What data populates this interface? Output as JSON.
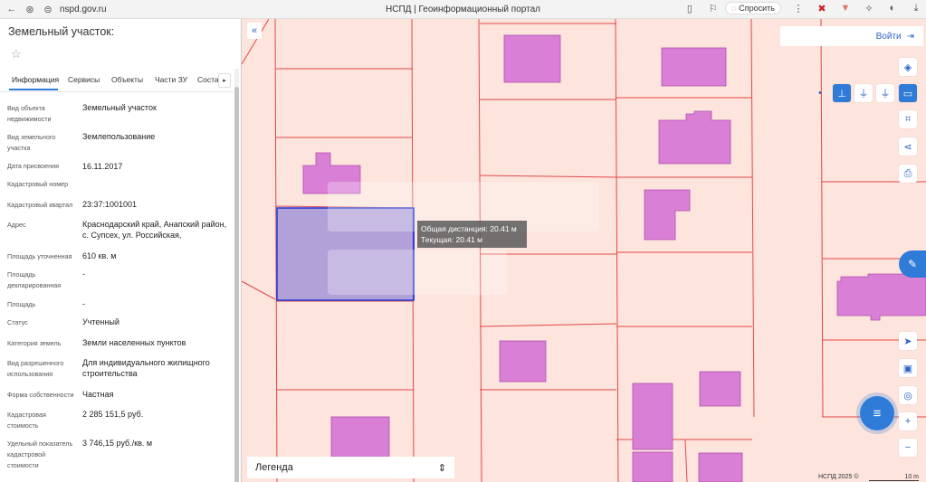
{
  "browser": {
    "url": "nspd.gov.ru",
    "title": "НСПД | Геоинформационный портал",
    "ask_label": "Спросить"
  },
  "panel": {
    "title": "Земельный участок:",
    "tabs": [
      "Информация",
      "Сервисы",
      "Объекты",
      "Части ЗУ",
      "Соста"
    ],
    "fields": [
      {
        "label": "Вид объекта недвижимости",
        "value": "Земельный участок"
      },
      {
        "label": "Вид земельного участка",
        "value": "Землепользование"
      },
      {
        "label": "Дата присвоения",
        "value": "16.11.2017"
      },
      {
        "label": "Кадастровый номер",
        "value": ""
      },
      {
        "label": "Кадастровый квартал",
        "value": "23:37:1001001"
      },
      {
        "label": "Адрес",
        "value": "Краснодарский край, Анапский район, с. Супсех, ул. Российская,"
      },
      {
        "label": "Площадь уточненная",
        "value": "610 кв. м"
      },
      {
        "label": "Площадь декларированная",
        "value": "-"
      },
      {
        "label": "Площадь",
        "value": "-"
      },
      {
        "label": "Статус",
        "value": "Учтенный"
      },
      {
        "label": "Категория земель",
        "value": "Земли населенных пунктов"
      },
      {
        "label": "Вид разрешенного использования",
        "value": "Для индивидуального жилищного строительства"
      },
      {
        "label": "Форма собственности",
        "value": "Частная"
      },
      {
        "label": "Кадастровая стоимость",
        "value": "2 285 151,5 руб."
      },
      {
        "label": "Удельный показатель кадастровой стоимости",
        "value": "3 746,15 руб./кв. м"
      }
    ]
  },
  "map": {
    "login_label": "Войти",
    "tooltip_total": "Общая дистанция: 20.41 м",
    "tooltip_current": "Текущая: 20.41 м",
    "legend_label": "Легенда",
    "copyright": "НСПД 2025 ©",
    "scale_label": "10 m",
    "colors": {
      "background": "#fde4dd",
      "boundary": "#e24848",
      "building": "#d97fd6",
      "selected_fill": "#a495d8",
      "selected_stroke": "#2b3fd6",
      "accent": "#2f7bd8"
    }
  }
}
